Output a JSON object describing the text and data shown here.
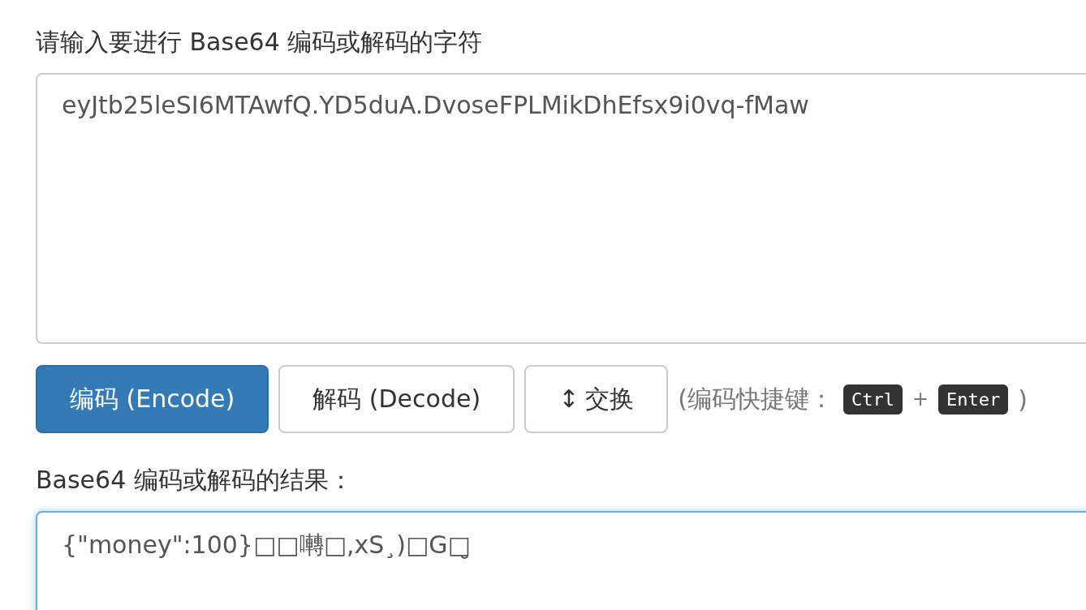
{
  "input_label": "请输入要进行 Base64 编码或解码的字符",
  "input": {
    "value": "eyJtb25leSI6MTAwfQ.YD5duA.DvoseFPLMikDhEfsx9i0vq-fMaw",
    "focused": false
  },
  "buttons": [
    {
      "label": "编码 (Encode)",
      "primary": true
    },
    {
      "label": "解码 (Decode)",
      "primary": false
    },
    {
      "label": "交换",
      "icon": "↕",
      "primary": false
    }
  ],
  "hint": {
    "prefix": "(编码快捷键：",
    "keys": [
      "Ctrl",
      "Enter"
    ],
    "plus": "+",
    "suffix": ")"
  },
  "result_label": "Base64 编码或解码的结果：",
  "result": {
    "value": "{\"money\":100}□□囀□,xS¸)□G□̮",
    "focused": true
  }
}
